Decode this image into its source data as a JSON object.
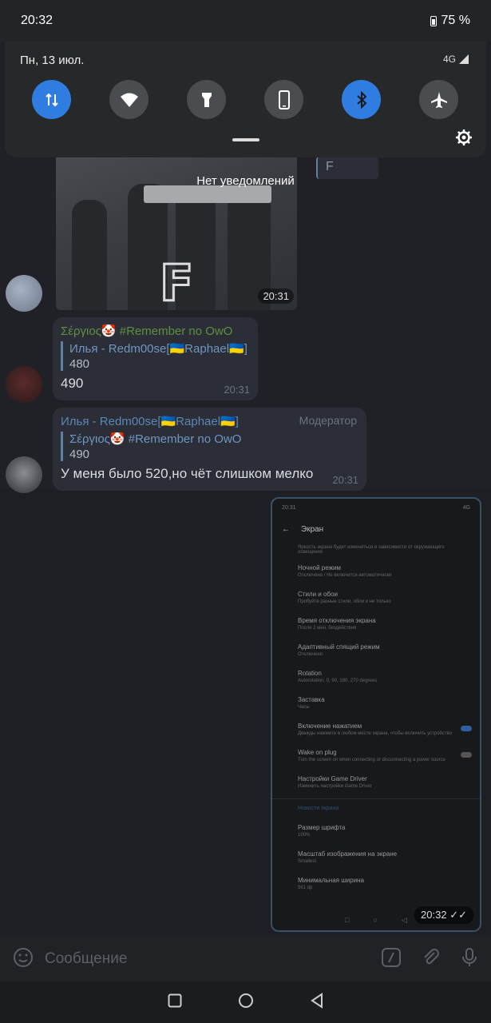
{
  "status": {
    "time": "20:32",
    "battery": "75 %"
  },
  "shade": {
    "date": "Пн, 13 июл.",
    "network": "4G",
    "tiles": [
      {
        "name": "data-tile",
        "on": true
      },
      {
        "name": "wifi-tile",
        "on": false
      },
      {
        "name": "flashlight-tile",
        "on": false
      },
      {
        "name": "rotate-tile",
        "on": false
      },
      {
        "name": "bluetooth-tile",
        "on": true
      },
      {
        "name": "airplane-tile",
        "on": false
      }
    ],
    "no_notifications": "Нет уведомлений"
  },
  "chat": {
    "photo": {
      "time": "20:31",
      "overlay_letter": "F",
      "reply_chip": "F"
    },
    "msg1": {
      "sender": "Σέργιος🤡 #Remember no OwO",
      "reply_name": "Илья - Redm00se[🇺🇦Raphael🇺🇦]",
      "reply_text": "480",
      "text": "490",
      "time": "20:31",
      "sender_color": "#5f8f3f"
    },
    "msg2": {
      "sender": "Илья - Redm00se[🇺🇦Raphael🇺🇦]",
      "role": "Модератор",
      "reply_name": "Σέργιος🤡 #Remember no OwO",
      "reply_text": "490",
      "text": "У меня было 520,но чёт слишком мелко",
      "time": "20:31",
      "sender_color": "#5b86b6"
    },
    "screenshot": {
      "time": "20:32",
      "status_time": "20:31",
      "status_right": "4G",
      "title": "Экран",
      "top_note": "Яркость экрана будет изменяться в зависимости от окружающего освещения",
      "items": [
        {
          "title": "Ночной режим",
          "sub": "Отключено / Не включится автоматически"
        },
        {
          "title": "Стили и обои",
          "sub": "Пробуйте разные стили, обои и не только"
        },
        {
          "title": "Время отключения экрана",
          "sub": "После 2 мин. бездействия"
        },
        {
          "title": "Адаптивный спящий режим",
          "sub": "Отключено"
        },
        {
          "title": "Rotation",
          "sub": "Autorotation, 0, 90, 180, 270 degrees"
        },
        {
          "title": "Заставка",
          "sub": "Часы"
        },
        {
          "title": "Включение нажатием",
          "sub": "Дважды нажмите в любом месте экрана, чтобы включить устройство"
        },
        {
          "title": "Wake on plug",
          "sub": "Turn the screen on when connecting or disconnecting a power source"
        },
        {
          "title": "Настройки Game Driver",
          "sub": "Изменить настройки Game Driver"
        }
      ],
      "section": "Новости экрана",
      "items2": [
        {
          "title": "Размер шрифта",
          "sub": "100%"
        },
        {
          "title": "Масштаб изображения на экране",
          "sub": "Smallest"
        },
        {
          "title": "Минимальная ширина",
          "sub": "561 dp"
        }
      ]
    }
  },
  "input": {
    "placeholder": "Сообщение"
  }
}
